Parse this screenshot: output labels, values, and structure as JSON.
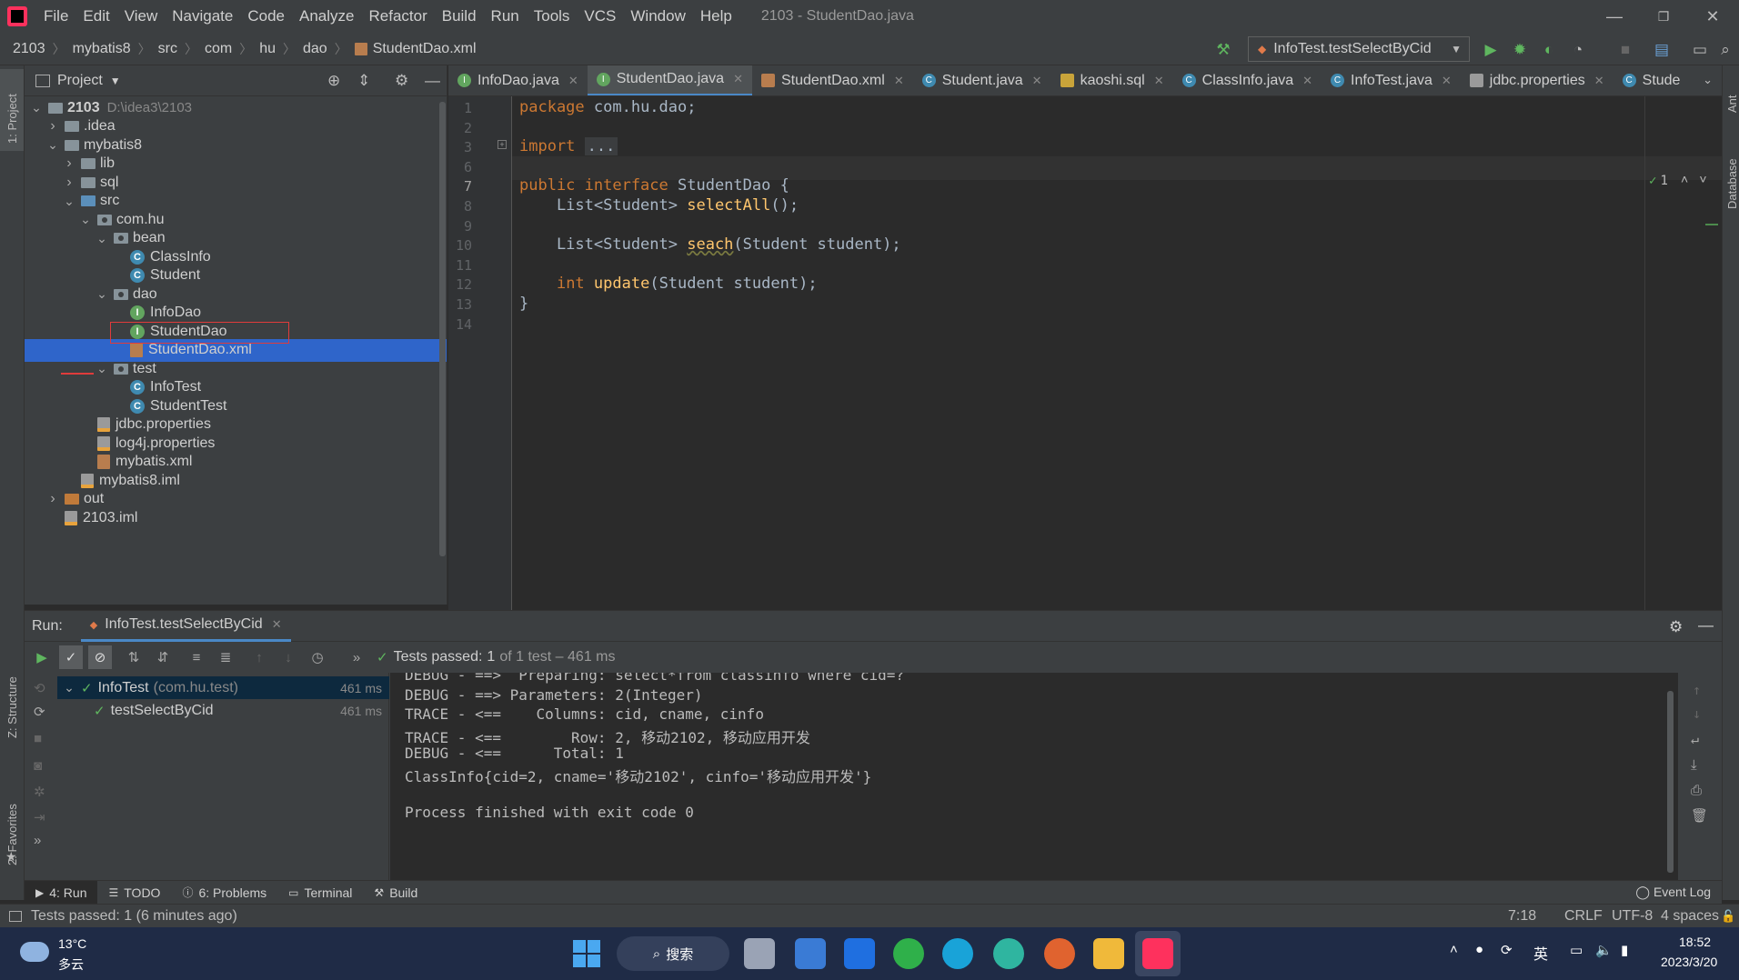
{
  "menubar": {
    "items": [
      "File",
      "Edit",
      "View",
      "Navigate",
      "Code",
      "Analyze",
      "Refactor",
      "Build",
      "Run",
      "Tools",
      "VCS",
      "Window",
      "Help"
    ],
    "window_title": "2103 - StudentDao.java"
  },
  "breadcrumb": [
    "2103",
    "mybatis8",
    "src",
    "com",
    "hu",
    "dao",
    "StudentDao.xml"
  ],
  "run_config": {
    "label": "InfoTest.testSelectByCid"
  },
  "left_strip": {
    "project": "1: Project",
    "structure": "Z: Structure",
    "favorites": "2: Favorites"
  },
  "right_strip": {
    "ant": "Ant",
    "database": "Database"
  },
  "project_panel": {
    "title": "Project",
    "tree": [
      {
        "label": "2103",
        "hint": "D:\\idea3\\2103",
        "depth": 0,
        "expanded": true,
        "icon": "folder-gray"
      },
      {
        "label": ".idea",
        "depth": 1,
        "expanded": false,
        "icon": "folder-gray"
      },
      {
        "label": "mybatis8",
        "depth": 1,
        "expanded": true,
        "icon": "folder-gray"
      },
      {
        "label": "lib",
        "depth": 2,
        "expanded": false,
        "icon": "folder-gray"
      },
      {
        "label": "sql",
        "depth": 2,
        "expanded": false,
        "icon": "folder-gray"
      },
      {
        "label": "src",
        "depth": 2,
        "expanded": true,
        "icon": "folder-blue"
      },
      {
        "label": "com.hu",
        "depth": 3,
        "expanded": true,
        "icon": "package"
      },
      {
        "label": "bean",
        "depth": 4,
        "expanded": true,
        "icon": "package"
      },
      {
        "label": "ClassInfo",
        "depth": 5,
        "icon": "class"
      },
      {
        "label": "Student",
        "depth": 5,
        "icon": "class"
      },
      {
        "label": "dao",
        "depth": 4,
        "expanded": true,
        "icon": "package"
      },
      {
        "label": "InfoDao",
        "depth": 5,
        "icon": "interface"
      },
      {
        "label": "StudentDao",
        "depth": 5,
        "icon": "interface"
      },
      {
        "label": "StudentDao.xml",
        "depth": 5,
        "icon": "xml",
        "selected": true
      },
      {
        "label": "test",
        "depth": 4,
        "expanded": true,
        "icon": "package"
      },
      {
        "label": "InfoTest",
        "depth": 5,
        "icon": "class"
      },
      {
        "label": "StudentTest",
        "depth": 5,
        "icon": "class"
      },
      {
        "label": "jdbc.properties",
        "depth": 3,
        "icon": "properties"
      },
      {
        "label": "log4j.properties",
        "depth": 3,
        "icon": "properties"
      },
      {
        "label": "mybatis.xml",
        "depth": 3,
        "icon": "xml"
      },
      {
        "label": "mybatis8.iml",
        "depth": 2,
        "icon": "iml"
      },
      {
        "label": "out",
        "depth": 1,
        "expanded": false,
        "icon": "folder-orange"
      },
      {
        "label": "2103.iml",
        "depth": 1,
        "icon": "iml"
      }
    ]
  },
  "editor_tabs": [
    {
      "label": "InfoDao.java",
      "icon": "interface"
    },
    {
      "label": "StudentDao.java",
      "icon": "interface",
      "active": true
    },
    {
      "label": "StudentDao.xml",
      "icon": "xml"
    },
    {
      "label": "Student.java",
      "icon": "class"
    },
    {
      "label": "kaoshi.sql",
      "icon": "sql"
    },
    {
      "label": "ClassInfo.java",
      "icon": "class"
    },
    {
      "label": "InfoTest.java",
      "icon": "class"
    },
    {
      "label": "jdbc.properties",
      "icon": "properties"
    },
    {
      "label": "Stude",
      "icon": "class"
    }
  ],
  "editor": {
    "line_numbers": [
      "1",
      "2",
      "3",
      "6",
      "7",
      "8",
      "9",
      "10",
      "11",
      "12",
      "13",
      "14"
    ],
    "inspection_count": "1",
    "lines": [
      [
        {
          "t": "package ",
          "c": "kw"
        },
        {
          "t": "com.hu.dao;",
          "c": ""
        }
      ],
      [],
      [
        {
          "t": "import ",
          "c": "kw"
        },
        {
          "t": "...",
          "c": ""
        }
      ],
      [],
      [
        {
          "t": "public interface ",
          "c": "kw"
        },
        {
          "t": "StudentDao {",
          "c": ""
        }
      ],
      [
        {
          "t": "    List<Student> ",
          "c": ""
        },
        {
          "t": "selectAll",
          "c": "fn"
        },
        {
          "t": "();",
          "c": ""
        }
      ],
      [],
      [
        {
          "t": "    List<Student> ",
          "c": ""
        },
        {
          "t": "seach",
          "c": "fn"
        },
        {
          "t": "(Student student);",
          "c": ""
        }
      ],
      [],
      [
        {
          "t": "    ",
          "c": ""
        },
        {
          "t": "int ",
          "c": "kw"
        },
        {
          "t": "update",
          "c": "fn"
        },
        {
          "t": "(Student student);",
          "c": ""
        }
      ],
      [
        {
          "t": "}",
          "c": ""
        }
      ],
      []
    ]
  },
  "run_panel": {
    "label": "Run:",
    "tab": "InfoTest.testSelectByCid",
    "status": "Tests passed:",
    "status_count": "1",
    "status_detail": "of 1 test – 461 ms",
    "tests": [
      {
        "name": "InfoTest",
        "pkg": "(com.hu.test)",
        "duration": "461 ms"
      },
      {
        "name": "testSelectByCid",
        "duration": "461 ms"
      }
    ],
    "console": [
      "DEBUG - ==>  Preparing: select*from classinfo where cid=?",
      "DEBUG - ==> Parameters: 2(Integer)",
      "TRACE - <==    Columns: cid, cname, cinfo",
      "TRACE - <==        Row: 2, 移动2102, 移动应用开发",
      "DEBUG - <==      Total: 1",
      "ClassInfo{cid=2, cname='移动2102', cinfo='移动应用开发'}",
      "",
      "Process finished with exit code 0"
    ]
  },
  "bottom_tabs": [
    "4: Run",
    "TODO",
    "6: Problems",
    "Terminal",
    "Build"
  ],
  "event_log": "Event Log",
  "statusbar": {
    "message": "Tests passed: 1 (6 minutes ago)",
    "position": "7:18",
    "line_sep": "CRLF",
    "encoding": "UTF-8",
    "indent": "4 spaces"
  },
  "taskbar": {
    "temperature": "13°C",
    "weather": "多云",
    "search": "搜索",
    "ime": "英",
    "time": "18:52",
    "date": "2023/3/20"
  }
}
